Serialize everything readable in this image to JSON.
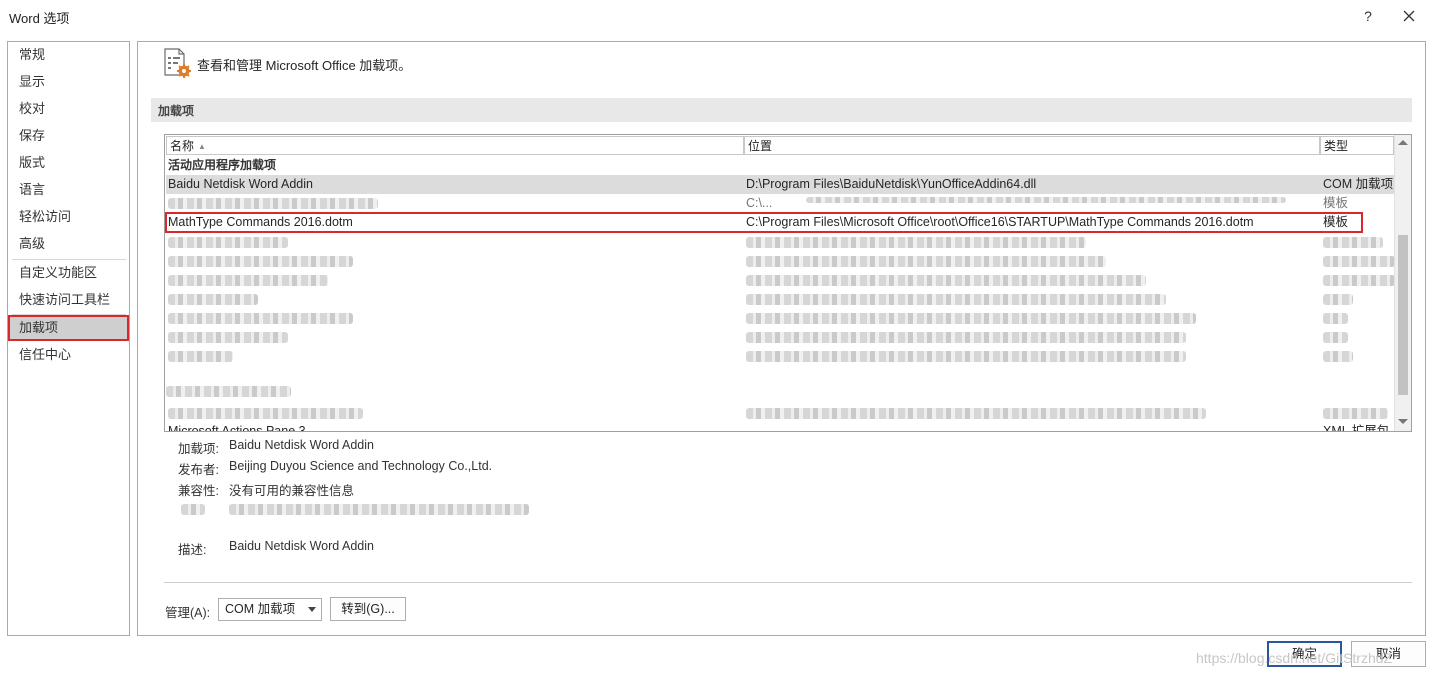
{
  "window": {
    "title": "Word 选项",
    "help_label": "?"
  },
  "sidebar": {
    "items": [
      {
        "label": "常规"
      },
      {
        "label": "显示"
      },
      {
        "label": "校对"
      },
      {
        "label": "保存"
      },
      {
        "label": "版式"
      },
      {
        "label": "语言"
      },
      {
        "label": "轻松访问"
      },
      {
        "label": "高级"
      },
      {
        "label": "自定义功能区"
      },
      {
        "label": "快速访问工具栏"
      },
      {
        "label": "加载项",
        "selected": true
      },
      {
        "label": "信任中心"
      }
    ]
  },
  "header": {
    "title": "查看和管理 Microsoft Office 加载项。",
    "icon": "addin-gear-icon"
  },
  "section": {
    "label": "加载项"
  },
  "list": {
    "columns": {
      "name": "名称",
      "location": "位置",
      "type": "类型"
    },
    "group_active": "活动应用程序加载项",
    "rows": [
      {
        "name": "Baidu Netdisk Word Addin",
        "location": "D:\\Program Files\\BaiduNetdisk\\YunOfficeAddin64.dll",
        "type": "COM 加载项"
      },
      {
        "name": "",
        "location": "C:\\...",
        "type": "模板"
      },
      {
        "name": "MathType Commands 2016.dotm",
        "location": "C:\\Program Files\\Microsoft Office\\root\\Office16\\STARTUP\\MathType Commands 2016.dotm",
        "type": "模板"
      }
    ],
    "last_row_name": "Microsoft Actions Pane 3",
    "last_row_type": "XML 扩展包"
  },
  "details": {
    "addin_label": "加载项:",
    "addin_value": "Baidu Netdisk Word Addin",
    "publisher_label": "发布者:",
    "publisher_value": "Beijing Duyou Science and Technology Co.,Ltd.",
    "compat_label": "兼容性:",
    "compat_value": "没有可用的兼容性信息",
    "desc_label": "描述:",
    "desc_value": "Baidu Netdisk Word Addin"
  },
  "manage": {
    "label": "管理(A):",
    "selected": "COM 加载项",
    "goto_label": "转到(G)..."
  },
  "buttons": {
    "ok": "确定",
    "cancel": "取消"
  },
  "watermark": "https://blog.csdn.net/GitStrzhdZ",
  "colors": {
    "highlight_red": "#d9282a",
    "selection_gray": "#cfcfcf",
    "primary_border": "#2b579a"
  }
}
